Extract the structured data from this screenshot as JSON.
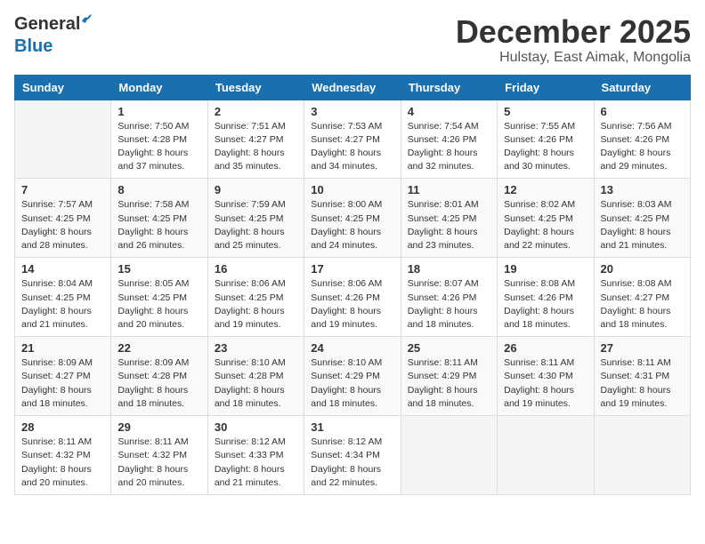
{
  "logo": {
    "general": "General",
    "blue": "Blue"
  },
  "header": {
    "month": "December 2025",
    "location": "Hulstay, East Aimak, Mongolia"
  },
  "days_of_week": [
    "Sunday",
    "Monday",
    "Tuesday",
    "Wednesday",
    "Thursday",
    "Friday",
    "Saturday"
  ],
  "weeks": [
    [
      {
        "day": "",
        "info": ""
      },
      {
        "day": "1",
        "info": "Sunrise: 7:50 AM\nSunset: 4:28 PM\nDaylight: 8 hours\nand 37 minutes."
      },
      {
        "day": "2",
        "info": "Sunrise: 7:51 AM\nSunset: 4:27 PM\nDaylight: 8 hours\nand 35 minutes."
      },
      {
        "day": "3",
        "info": "Sunrise: 7:53 AM\nSunset: 4:27 PM\nDaylight: 8 hours\nand 34 minutes."
      },
      {
        "day": "4",
        "info": "Sunrise: 7:54 AM\nSunset: 4:26 PM\nDaylight: 8 hours\nand 32 minutes."
      },
      {
        "day": "5",
        "info": "Sunrise: 7:55 AM\nSunset: 4:26 PM\nDaylight: 8 hours\nand 30 minutes."
      },
      {
        "day": "6",
        "info": "Sunrise: 7:56 AM\nSunset: 4:26 PM\nDaylight: 8 hours\nand 29 minutes."
      }
    ],
    [
      {
        "day": "7",
        "info": "Sunrise: 7:57 AM\nSunset: 4:25 PM\nDaylight: 8 hours\nand 28 minutes."
      },
      {
        "day": "8",
        "info": "Sunrise: 7:58 AM\nSunset: 4:25 PM\nDaylight: 8 hours\nand 26 minutes."
      },
      {
        "day": "9",
        "info": "Sunrise: 7:59 AM\nSunset: 4:25 PM\nDaylight: 8 hours\nand 25 minutes."
      },
      {
        "day": "10",
        "info": "Sunrise: 8:00 AM\nSunset: 4:25 PM\nDaylight: 8 hours\nand 24 minutes."
      },
      {
        "day": "11",
        "info": "Sunrise: 8:01 AM\nSunset: 4:25 PM\nDaylight: 8 hours\nand 23 minutes."
      },
      {
        "day": "12",
        "info": "Sunrise: 8:02 AM\nSunset: 4:25 PM\nDaylight: 8 hours\nand 22 minutes."
      },
      {
        "day": "13",
        "info": "Sunrise: 8:03 AM\nSunset: 4:25 PM\nDaylight: 8 hours\nand 21 minutes."
      }
    ],
    [
      {
        "day": "14",
        "info": "Sunrise: 8:04 AM\nSunset: 4:25 PM\nDaylight: 8 hours\nand 21 minutes."
      },
      {
        "day": "15",
        "info": "Sunrise: 8:05 AM\nSunset: 4:25 PM\nDaylight: 8 hours\nand 20 minutes."
      },
      {
        "day": "16",
        "info": "Sunrise: 8:06 AM\nSunset: 4:25 PM\nDaylight: 8 hours\nand 19 minutes."
      },
      {
        "day": "17",
        "info": "Sunrise: 8:06 AM\nSunset: 4:26 PM\nDaylight: 8 hours\nand 19 minutes."
      },
      {
        "day": "18",
        "info": "Sunrise: 8:07 AM\nSunset: 4:26 PM\nDaylight: 8 hours\nand 18 minutes."
      },
      {
        "day": "19",
        "info": "Sunrise: 8:08 AM\nSunset: 4:26 PM\nDaylight: 8 hours\nand 18 minutes."
      },
      {
        "day": "20",
        "info": "Sunrise: 8:08 AM\nSunset: 4:27 PM\nDaylight: 8 hours\nand 18 minutes."
      }
    ],
    [
      {
        "day": "21",
        "info": "Sunrise: 8:09 AM\nSunset: 4:27 PM\nDaylight: 8 hours\nand 18 minutes."
      },
      {
        "day": "22",
        "info": "Sunrise: 8:09 AM\nSunset: 4:28 PM\nDaylight: 8 hours\nand 18 minutes."
      },
      {
        "day": "23",
        "info": "Sunrise: 8:10 AM\nSunset: 4:28 PM\nDaylight: 8 hours\nand 18 minutes."
      },
      {
        "day": "24",
        "info": "Sunrise: 8:10 AM\nSunset: 4:29 PM\nDaylight: 8 hours\nand 18 minutes."
      },
      {
        "day": "25",
        "info": "Sunrise: 8:11 AM\nSunset: 4:29 PM\nDaylight: 8 hours\nand 18 minutes."
      },
      {
        "day": "26",
        "info": "Sunrise: 8:11 AM\nSunset: 4:30 PM\nDaylight: 8 hours\nand 19 minutes."
      },
      {
        "day": "27",
        "info": "Sunrise: 8:11 AM\nSunset: 4:31 PM\nDaylight: 8 hours\nand 19 minutes."
      }
    ],
    [
      {
        "day": "28",
        "info": "Sunrise: 8:11 AM\nSunset: 4:32 PM\nDaylight: 8 hours\nand 20 minutes."
      },
      {
        "day": "29",
        "info": "Sunrise: 8:11 AM\nSunset: 4:32 PM\nDaylight: 8 hours\nand 20 minutes."
      },
      {
        "day": "30",
        "info": "Sunrise: 8:12 AM\nSunset: 4:33 PM\nDaylight: 8 hours\nand 21 minutes."
      },
      {
        "day": "31",
        "info": "Sunrise: 8:12 AM\nSunset: 4:34 PM\nDaylight: 8 hours\nand 22 minutes."
      },
      {
        "day": "",
        "info": ""
      },
      {
        "day": "",
        "info": ""
      },
      {
        "day": "",
        "info": ""
      }
    ]
  ]
}
